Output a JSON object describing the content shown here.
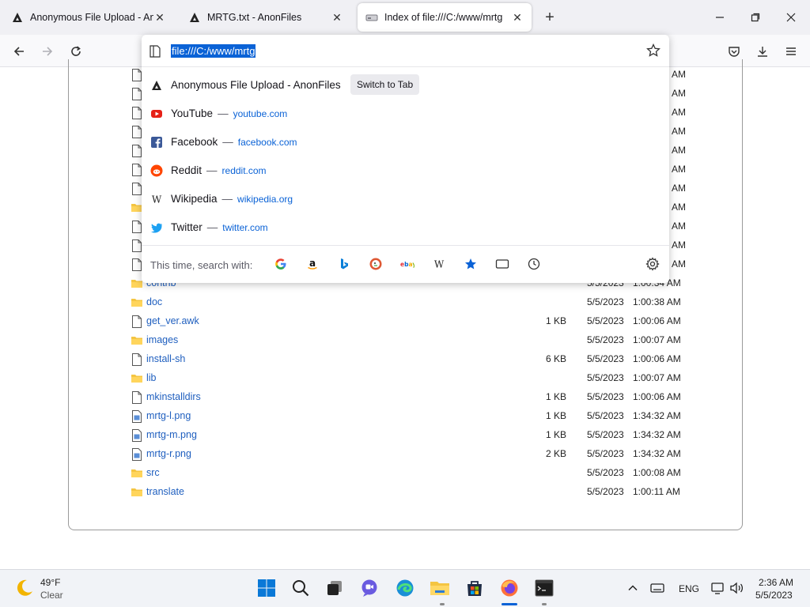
{
  "tabs": [
    {
      "title": "Anonymous File Upload - AnonFiles",
      "active": false
    },
    {
      "title": "MRTG.txt - AnonFiles",
      "active": false
    },
    {
      "title": "Index of file:///C:/www/mrtg",
      "active": true
    }
  ],
  "url_bar": {
    "value": "file:///C:/www/mrtg"
  },
  "suggestions": [
    {
      "title": "Anonymous File Upload - AnonFiles",
      "action": "Switch to Tab",
      "icon": "anonfiles-icon"
    },
    {
      "title": "YouTube",
      "sep": "—",
      "url": "youtube.com",
      "icon": "youtube-icon"
    },
    {
      "title": "Facebook",
      "sep": "—",
      "url": "facebook.com",
      "icon": "facebook-icon"
    },
    {
      "title": "Reddit",
      "sep": "—",
      "url": "reddit.com",
      "icon": "reddit-icon"
    },
    {
      "title": "Wikipedia",
      "sep": "—",
      "url": "wikipedia.org",
      "icon": "wikipedia-icon"
    },
    {
      "title": "Twitter",
      "sep": "—",
      "url": "twitter.com",
      "icon": "twitter-icon"
    }
  ],
  "search_with": {
    "label": "This time, search with:",
    "engines": [
      "google-icon",
      "amazon-icon",
      "bing-icon",
      "duckduckgo-icon",
      "ebay-icon",
      "wikipedia-icon",
      "bookmarks-icon",
      "tabs-icon",
      "history-icon"
    ]
  },
  "partial_rows": [
    {
      "time_tail": "AM",
      "type": "file"
    },
    {
      "time_tail": "AM",
      "type": "file"
    },
    {
      "time_tail": "AM",
      "type": "file"
    },
    {
      "time_tail": "AM",
      "type": "file"
    },
    {
      "time_tail": "AM",
      "type": "file"
    },
    {
      "time_tail": "AM",
      "type": "file"
    },
    {
      "time_tail": "AM",
      "type": "file"
    },
    {
      "time_tail": "AM",
      "type": "folder"
    },
    {
      "time_tail": "AM",
      "type": "file"
    },
    {
      "time_tail": "AM",
      "type": "file"
    },
    {
      "time_tail": "AM",
      "type": "file"
    }
  ],
  "files": [
    {
      "name": "contrib",
      "type": "folder",
      "size": "",
      "date": "5/5/2023",
      "time": "1:00:34 AM"
    },
    {
      "name": "doc",
      "type": "folder",
      "size": "",
      "date": "5/5/2023",
      "time": "1:00:38 AM"
    },
    {
      "name": "get_ver.awk",
      "type": "file",
      "size": "1 KB",
      "date": "5/5/2023",
      "time": "1:00:06 AM"
    },
    {
      "name": "images",
      "type": "folder",
      "size": "",
      "date": "5/5/2023",
      "time": "1:00:07 AM"
    },
    {
      "name": "install-sh",
      "type": "file",
      "size": "6 KB",
      "date": "5/5/2023",
      "time": "1:00:06 AM"
    },
    {
      "name": "lib",
      "type": "folder",
      "size": "",
      "date": "5/5/2023",
      "time": "1:00:07 AM"
    },
    {
      "name": "mkinstalldirs",
      "type": "file",
      "size": "1 KB",
      "date": "5/5/2023",
      "time": "1:00:06 AM"
    },
    {
      "name": "mrtg-l.png",
      "type": "image",
      "size": "1 KB",
      "date": "5/5/2023",
      "time": "1:34:32 AM"
    },
    {
      "name": "mrtg-m.png",
      "type": "image",
      "size": "1 KB",
      "date": "5/5/2023",
      "time": "1:34:32 AM"
    },
    {
      "name": "mrtg-r.png",
      "type": "image",
      "size": "2 KB",
      "date": "5/5/2023",
      "time": "1:34:32 AM"
    },
    {
      "name": "src",
      "type": "folder",
      "size": "",
      "date": "5/5/2023",
      "time": "1:00:08 AM"
    },
    {
      "name": "translate",
      "type": "folder",
      "size": "",
      "date": "5/5/2023",
      "time": "1:00:11 AM"
    }
  ],
  "taskbar": {
    "weather_temp": "49°F",
    "weather_desc": "Clear",
    "lang": "ENG",
    "time": "2:36 AM",
    "date": "5/5/2023"
  },
  "colors": {
    "accent": "#0a62d6",
    "link": "#1f5fbf",
    "folder": "#f4c542"
  }
}
